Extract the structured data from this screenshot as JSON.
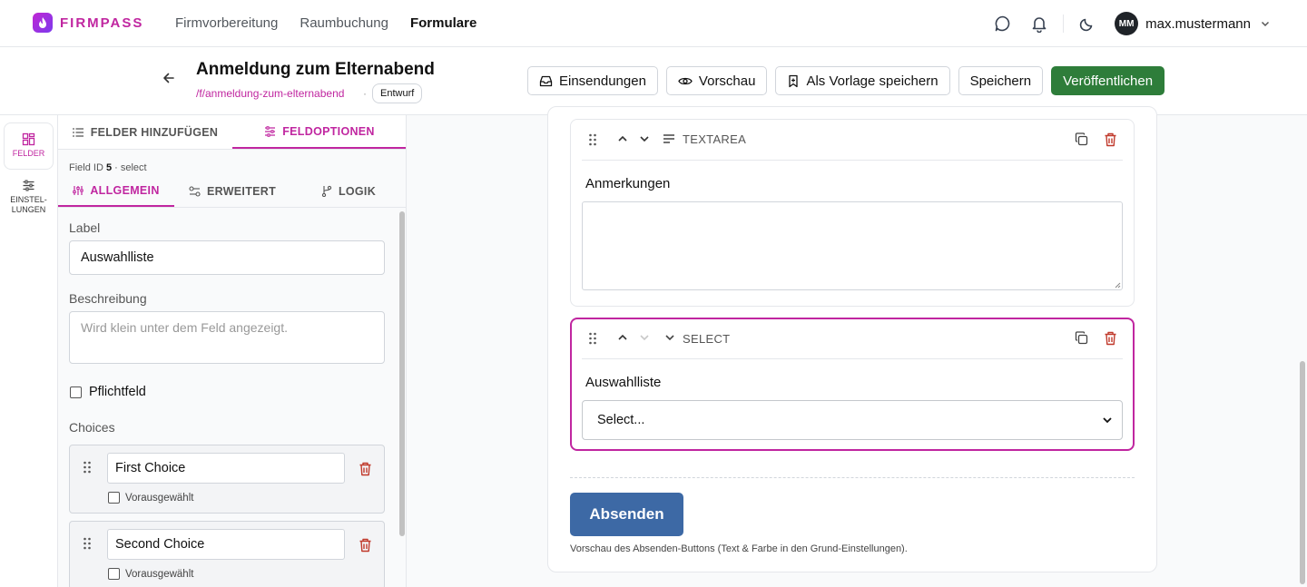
{
  "brand": {
    "name": "FIRMPASS",
    "accent": "#c026a0"
  },
  "nav": {
    "links": [
      {
        "label": "Firmvorbereitung"
      },
      {
        "label": "Raumbuchung"
      },
      {
        "label": "Formulare",
        "active": true
      }
    ],
    "icons": [
      "chat-icon",
      "bell-icon",
      "moon-icon"
    ],
    "user": {
      "initials": "MM",
      "name": "max.mustermann"
    }
  },
  "header": {
    "title": "Anmeldung zum Elternabend",
    "slug": "/f/anmeldung-zum-elternabend",
    "separator": "·",
    "status": "Entwurf",
    "actions": {
      "submissions": "Einsendungen",
      "preview": "Vorschau",
      "save_template": "Als Vorlage speichern",
      "save": "Speichern",
      "publish": "Veröffentlichen"
    },
    "publish_color": "#2e7d3a"
  },
  "rail": {
    "fields": "FELDER",
    "settings_line1": "EINSTEL-",
    "settings_line2": "LUNGEN"
  },
  "panel": {
    "tabs": {
      "add_fields": "FELDER HINZUFÜGEN",
      "field_options": "FELDOPTIONEN"
    },
    "field_id_label": "Field ID",
    "field_id": "5",
    "field_type": "· select",
    "subtabs": {
      "general": "ALLGEMEIN",
      "advanced": "ERWEITERT",
      "logic": "LOGIK"
    },
    "label_title": "Label",
    "label_value": "Auswahlliste",
    "description_title": "Beschreibung",
    "description_placeholder": "Wird klein unter dem Feld angezeigt.",
    "required_label": "Pflichtfeld",
    "required": false,
    "choices_title": "Choices",
    "choices": [
      {
        "label": "First Choice",
        "preselected_label": "Vorausgewählt",
        "preselected": false
      },
      {
        "label": "Second Choice",
        "preselected_label": "Vorausgewählt",
        "preselected": false
      }
    ]
  },
  "preview": {
    "blocks": [
      {
        "type": "TEXTAREA",
        "label": "Anmerkungen"
      },
      {
        "type": "SELECT",
        "label": "Auswahlliste",
        "select_value": "Select..."
      }
    ],
    "submit_label": "Absenden",
    "submit_color": "#3d69a5",
    "submit_note": "Vorschau des Absenden-Buttons (Text & Farbe in den Grund-Einstellungen)."
  }
}
